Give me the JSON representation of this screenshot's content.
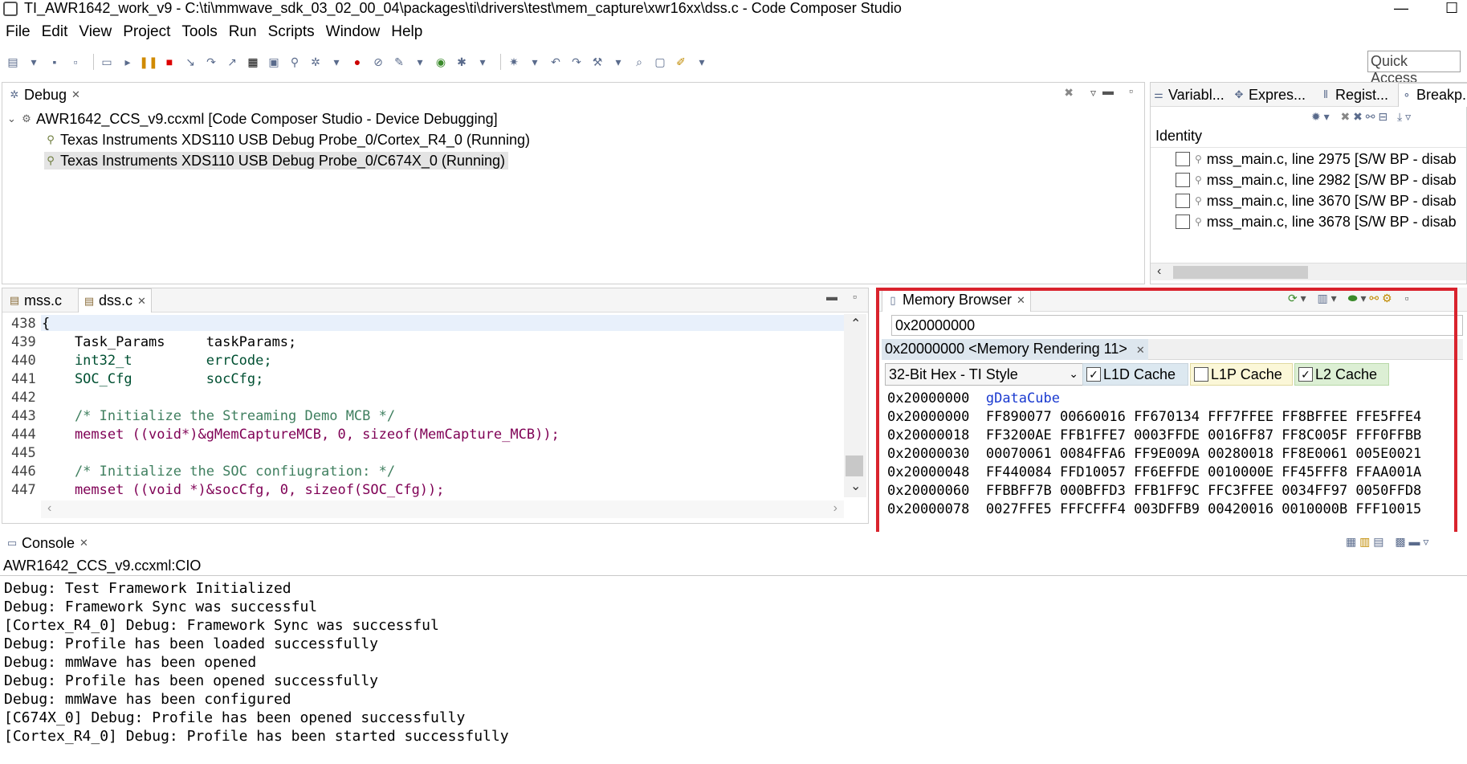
{
  "window": {
    "title": "TI_AWR1642_work_v9 - C:\\ti\\mmwave_sdk_03_02_00_04\\packages\\ti\\drivers\\test\\mem_capture\\xwr16xx\\dss.c - Code Composer Studio",
    "minimize": "—",
    "maximize": "☐"
  },
  "menu": [
    "File",
    "Edit",
    "View",
    "Project",
    "Tools",
    "Run",
    "Scripts",
    "Window",
    "Help"
  ],
  "toolbar": {
    "quick_access": "Quick Access"
  },
  "debug_view": {
    "tab_label": "Debug",
    "tree": [
      {
        "label": "AWR1642_CCS_v9.ccxml [Code Composer Studio - Device Debugging]"
      },
      {
        "label": "Texas Instruments XDS110 USB Debug Probe_0/Cortex_R4_0 (Running)"
      },
      {
        "label": "Texas Instruments XDS110 USB Debug Probe_0/C674X_0 (Running)"
      }
    ]
  },
  "right_top": {
    "tabs": [
      "Variabl...",
      "Expres...",
      "Regist...",
      "Breakp..."
    ],
    "column_header": "Identity",
    "breakpoints": [
      "mss_main.c, line 2975 [S/W BP - disab",
      "mss_main.c, line 2982 [S/W BP - disab",
      "mss_main.c, line 3670 [S/W BP - disab",
      "mss_main.c, line 3678 [S/W BP - disab"
    ]
  },
  "editor": {
    "tabs": [
      "mss.c",
      "dss.c"
    ],
    "lines": [
      {
        "num": "438",
        "text": "{"
      },
      {
        "num": "439",
        "text": "    Task_Params     taskParams;"
      },
      {
        "num": "440",
        "text": "    int32_t         errCode;"
      },
      {
        "num": "441",
        "text": "    SOC_Cfg         socCfg;"
      },
      {
        "num": "442",
        "text": ""
      },
      {
        "num": "443",
        "text": "    /* Initialize the Streaming Demo MCB */"
      },
      {
        "num": "444",
        "text": "    memset ((void*)&gMemCaptureMCB, 0, sizeof(MemCapture_MCB));"
      },
      {
        "num": "445",
        "text": ""
      },
      {
        "num": "446",
        "text": "    /* Initialize the SOC confiugration: */"
      },
      {
        "num": "447",
        "text": "    memset ((void *)&socCfg, 0, sizeof(SOC_Cfg));"
      }
    ]
  },
  "memory_browser": {
    "tab_label": "Memory Browser",
    "address_input": "0x20000000",
    "rendering_tab": "0x20000000 <Memory Rendering 11>",
    "format_select": "32-Bit Hex - TI Style",
    "cache_options": [
      {
        "label": "L1D Cache",
        "checked": true
      },
      {
        "label": "L1P Cache",
        "checked": false
      },
      {
        "label": "L2 Cache",
        "checked": true
      }
    ],
    "symbol_row": {
      "address": "0x20000000",
      "symbol": "gDataCube"
    },
    "rows": [
      {
        "address": "0x20000000",
        "words": "FF890077 00660016 FF670134 FFF7FFEE FF8BFFEE FFE5FFE4"
      },
      {
        "address": "0x20000018",
        "words": "FF3200AE FFB1FFE7 0003FFDE 0016FF87 FF8C005F FFF0FFBB"
      },
      {
        "address": "0x20000030",
        "words": "00070061 0084FFA6 FF9E009A 00280018 FF8E0061 005E0021"
      },
      {
        "address": "0x20000048",
        "words": "FF440084 FFD10057 FF6EFFDE 0010000E FF45FFF8 FFAA001A"
      },
      {
        "address": "0x20000060",
        "words": "FFBBFF7B 000BFFD3 FFB1FF9C FFC3FFEE 0034FF97 0050FFD8"
      },
      {
        "address": "0x20000078",
        "words": "0027FFE5 FFFCFFF4 003DFFB9 00420016 0010000B FFF10015"
      }
    ],
    "highlight_color": "#d9232d"
  },
  "console": {
    "tab_label": "Console",
    "source": "AWR1642_CCS_v9.ccxml:CIO",
    "lines": [
      "Debug: Test Framework Initialized",
      "Debug: Framework Sync was successful",
      "[Cortex_R4_0] Debug: Framework Sync was successful",
      "Debug: Profile has been loaded successfully",
      "Debug: mmWave has been opened",
      "Debug: Profile has been opened successfully",
      "Debug: mmWave has been configured",
      "[C674X_0] Debug: Profile has been opened successfully",
      "[Cortex_R4_0] Debug: Profile has been started successfully"
    ]
  }
}
